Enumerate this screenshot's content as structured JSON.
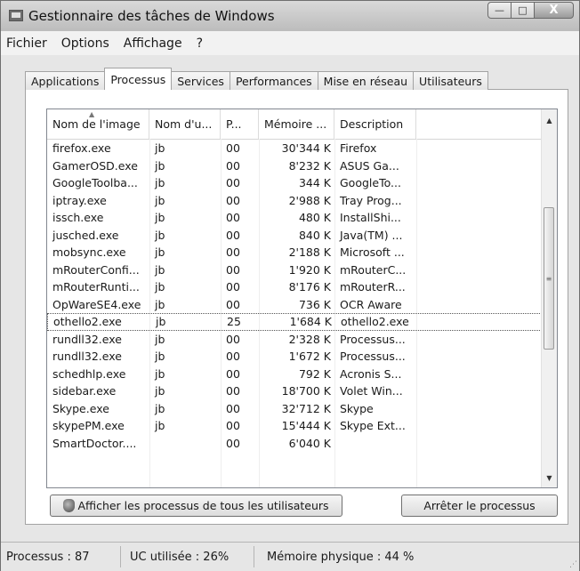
{
  "window": {
    "title": "Gestionnaire des tâches de Windows"
  },
  "caption": {
    "minimize": "—",
    "maximize": "□",
    "close": "X"
  },
  "menu": [
    "Fichier",
    "Options",
    "Affichage",
    "?"
  ],
  "tabs": [
    "Applications",
    "Processus",
    "Services",
    "Performances",
    "Mise en réseau",
    "Utilisateurs"
  ],
  "active_tab": "Processus",
  "columns": [
    "Nom de l'image",
    "Nom d'u...",
    "P...",
    "Mémoire ...",
    "Description"
  ],
  "rows": [
    {
      "image": "firefox.exe",
      "user": "jb",
      "cpu": "00",
      "memory": "30'344 K",
      "desc": "Firefox"
    },
    {
      "image": "GamerOSD.exe",
      "user": "jb",
      "cpu": "00",
      "memory": "8'232 K",
      "desc": "ASUS Ga..."
    },
    {
      "image": "GoogleToolba...",
      "user": "jb",
      "cpu": "00",
      "memory": "344 K",
      "desc": "GoogleTo..."
    },
    {
      "image": "iptray.exe",
      "user": "jb",
      "cpu": "00",
      "memory": "2'988 K",
      "desc": "Tray Prog..."
    },
    {
      "image": "issch.exe",
      "user": "jb",
      "cpu": "00",
      "memory": "480 K",
      "desc": "InstallShi..."
    },
    {
      "image": "jusched.exe",
      "user": "jb",
      "cpu": "00",
      "memory": "840 K",
      "desc": "Java(TM) ..."
    },
    {
      "image": "mobsync.exe",
      "user": "jb",
      "cpu": "00",
      "memory": "2'188 K",
      "desc": "Microsoft ..."
    },
    {
      "image": "mRouterConfi...",
      "user": "jb",
      "cpu": "00",
      "memory": "1'920 K",
      "desc": "mRouterC..."
    },
    {
      "image": "mRouterRunti...",
      "user": "jb",
      "cpu": "00",
      "memory": "8'176 K",
      "desc": "mRouterR..."
    },
    {
      "image": "OpWareSE4.exe",
      "user": "jb",
      "cpu": "00",
      "memory": "736 K",
      "desc": "OCR Aware"
    },
    {
      "image": "othello2.exe",
      "user": "jb",
      "cpu": "25",
      "memory": "1'684 K",
      "desc": "othello2.exe",
      "selected": true
    },
    {
      "image": "rundll32.exe",
      "user": "jb",
      "cpu": "00",
      "memory": "2'328 K",
      "desc": "Processus..."
    },
    {
      "image": "rundll32.exe",
      "user": "jb",
      "cpu": "00",
      "memory": "1'672 K",
      "desc": "Processus..."
    },
    {
      "image": "schedhlp.exe",
      "user": "jb",
      "cpu": "00",
      "memory": "792 K",
      "desc": "Acronis S..."
    },
    {
      "image": "sidebar.exe",
      "user": "jb",
      "cpu": "00",
      "memory": "18'700 K",
      "desc": "Volet Win..."
    },
    {
      "image": "Skype.exe",
      "user": "jb",
      "cpu": "00",
      "memory": "32'712 K",
      "desc": "Skype"
    },
    {
      "image": "skypePM.exe",
      "user": "jb",
      "cpu": "00",
      "memory": "15'444 K",
      "desc": "Skype Ext..."
    },
    {
      "image": "SmartDoctor....",
      "user": "",
      "cpu": "00",
      "memory": "6'040 K",
      "desc": ""
    }
  ],
  "buttons": {
    "show_all": "Afficher les processus de tous les utilisateurs",
    "end_process": "Arrêter le processus"
  },
  "status": {
    "processes": "Processus : 87",
    "cpu": "UC utilisée : 26%",
    "memory": "Mémoire physique : 44 %"
  },
  "icons": {
    "app": "task-manager-icon",
    "shield": "uac-shield-icon",
    "scroll_up": "▲",
    "scroll_down": "▼",
    "thumb_grip": "≡",
    "resize_grip": "⋰"
  }
}
